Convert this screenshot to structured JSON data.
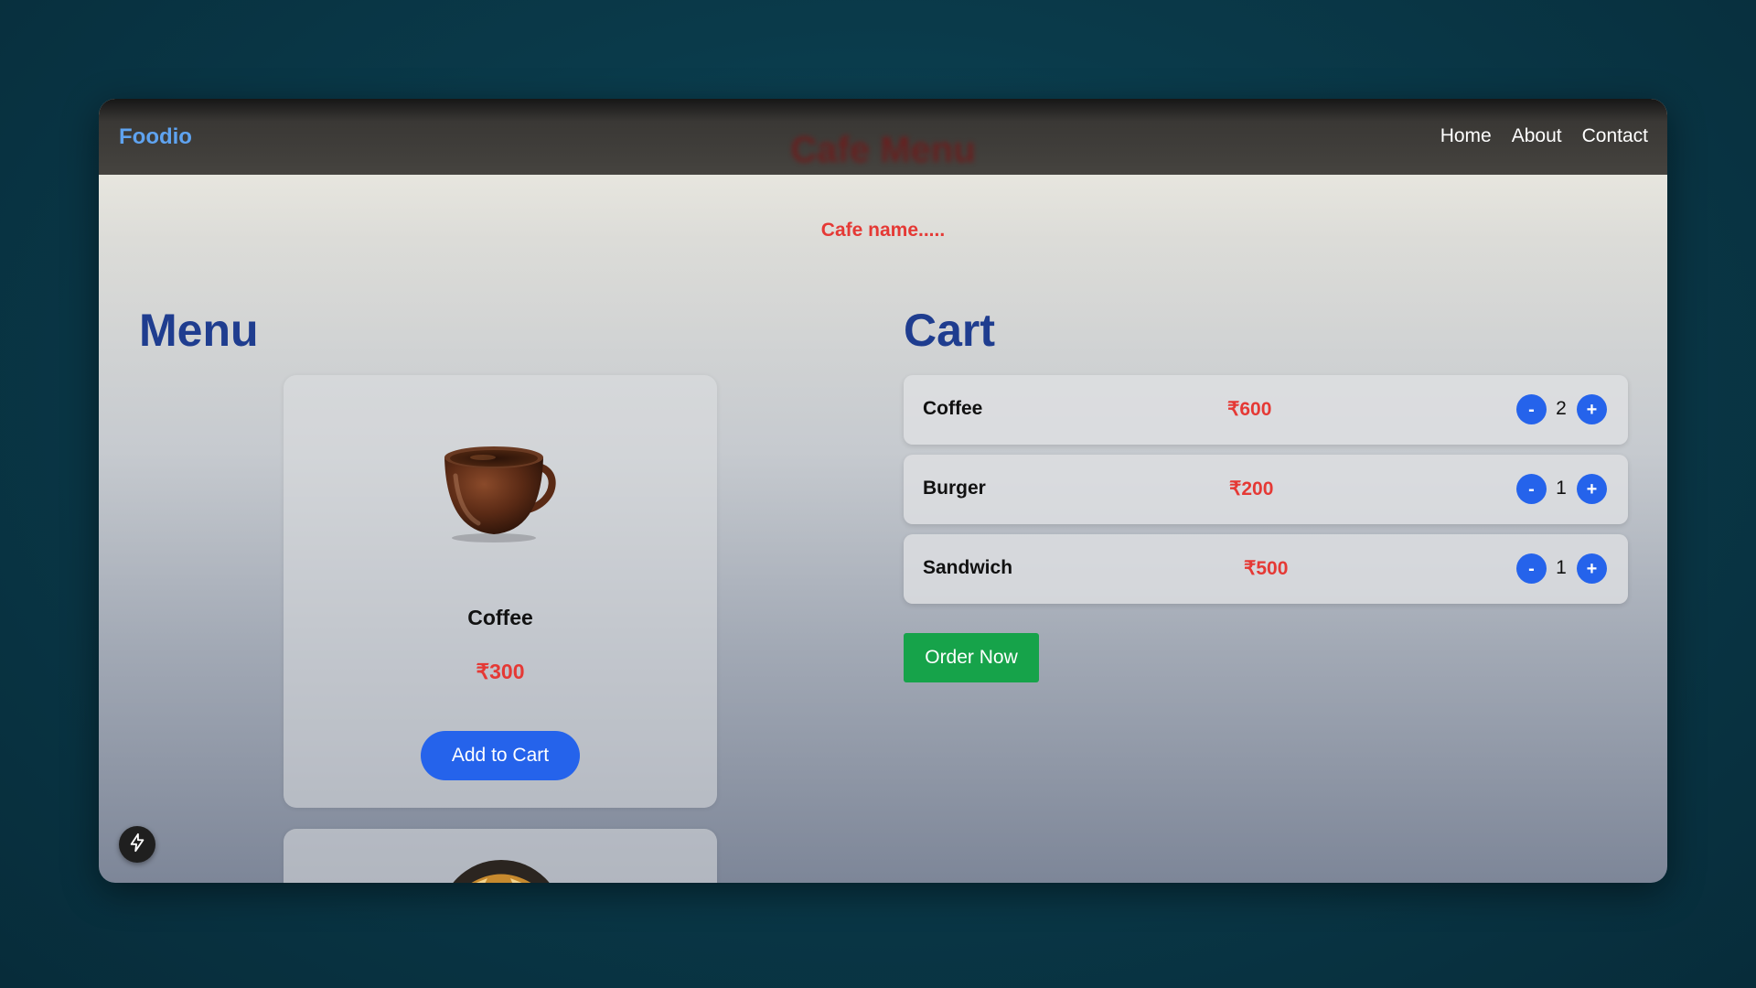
{
  "navbar": {
    "brand": "Foodio",
    "title": "Cafe Menu",
    "links": [
      "Home",
      "About",
      "Contact"
    ]
  },
  "subtitle": "Cafe name.....",
  "menu": {
    "title": "Menu",
    "items": [
      {
        "name": "Coffee",
        "price": "₹300",
        "button": "Add to Cart",
        "icon": "coffee-cup-image"
      },
      {
        "icon": "burger-image"
      }
    ]
  },
  "cart": {
    "title": "Cart",
    "items": [
      {
        "name": "Coffee",
        "price": "₹600",
        "qty": "2",
        "minus": "-",
        "plus": "+"
      },
      {
        "name": "Burger",
        "price": "₹200",
        "qty": "1",
        "minus": "-",
        "plus": "+"
      },
      {
        "name": "Sandwich",
        "price": "₹500",
        "qty": "1",
        "minus": "-",
        "plus": "+"
      }
    ],
    "order_button": "Order Now"
  },
  "fab_icon": "lightning-bolt-icon",
  "colors": {
    "brand": "#5fa3f0",
    "heading": "#1f3d8f",
    "price": "#e53935",
    "primary_button": "#2563eb",
    "order_button": "#16a34a"
  }
}
